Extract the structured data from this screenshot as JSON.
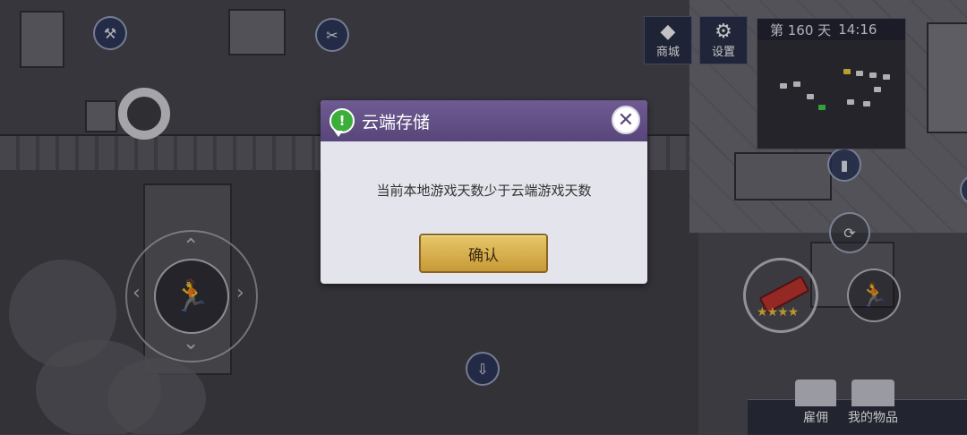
{
  "hud": {
    "shop_label": "商城",
    "settings_label": "设置",
    "day_text": "第 160 天",
    "time_text": "14:16",
    "hire_label": "雇佣",
    "inventory_label": "我的物品",
    "weapon_stars": "★★★★"
  },
  "dialog": {
    "title": "云端存储",
    "message": "当前本地游戏天数少于云端游戏天数",
    "confirm_label": "确认",
    "close_glyph": "✕",
    "info_glyph": "!"
  },
  "icons": {
    "shop": "diamond-icon",
    "settings": "gear-icon",
    "sprint": "running-man-icon"
  },
  "colors": {
    "dialog_header": "#5f4d84",
    "confirm_gold": "#d9b04e",
    "info_green": "#3cae3a"
  }
}
